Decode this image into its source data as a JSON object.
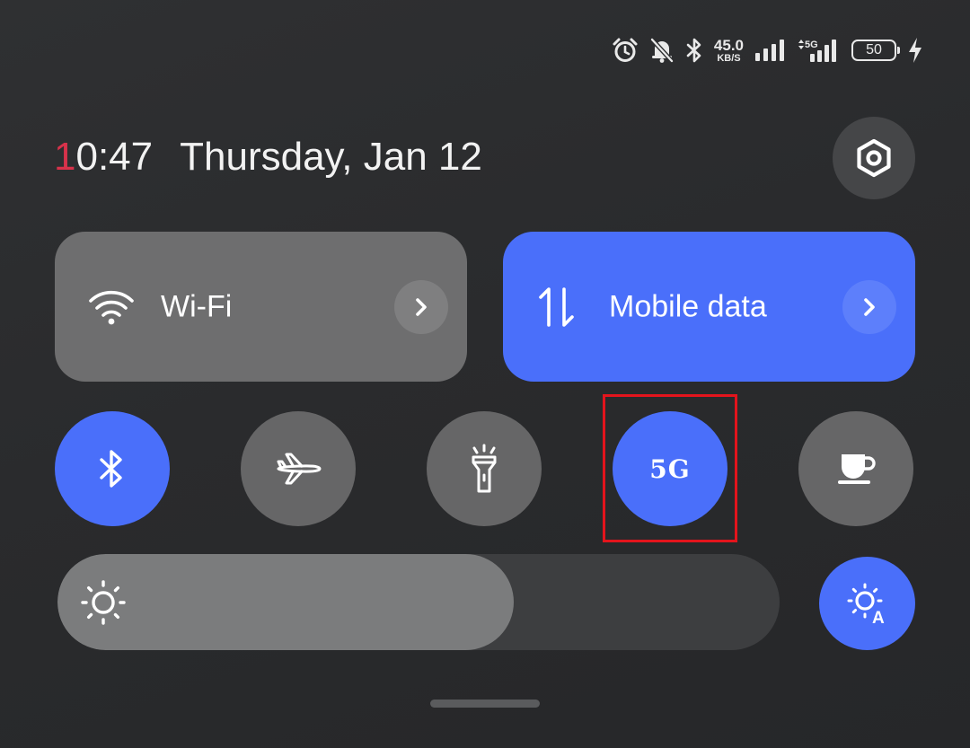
{
  "status_bar": {
    "icons": [
      "alarm-icon",
      "bell-off-icon",
      "bluetooth-icon",
      "signal-icon",
      "5g-signal-icon",
      "charging-icon"
    ],
    "speed_value": "45.0",
    "speed_unit": "KB/S",
    "network_label": "5G",
    "battery_level": "50"
  },
  "header": {
    "time_first_digit": "1",
    "time_rest": "0:47",
    "date": "Thursday, Jan 12",
    "settings_icon": "settings-hexagon-icon"
  },
  "tiles": {
    "wifi": {
      "label": "Wi-Fi",
      "icon": "wifi-icon",
      "active": false
    },
    "mobile_data": {
      "label": "Mobile data",
      "icon": "data-arrows-icon",
      "active": true
    }
  },
  "toggles": [
    {
      "name": "bluetooth",
      "icon": "bluetooth-icon",
      "active": true
    },
    {
      "name": "airplane-mode",
      "icon": "airplane-icon",
      "active": false
    },
    {
      "name": "flashlight",
      "icon": "flashlight-icon",
      "active": false
    },
    {
      "name": "5g",
      "label": "5G",
      "active": true,
      "highlighted": true
    },
    {
      "name": "reading-mode",
      "icon": "cup-icon",
      "active": false
    }
  ],
  "brightness": {
    "level": 0.632,
    "icon": "sun-icon",
    "auto_icon": "auto-brightness-icon"
  },
  "colors": {
    "accent": "#4a6ffa",
    "tile_off": "#6e6e6f",
    "toggle_off": "#666667",
    "highlight": "#e3141c",
    "clock_accent": "#d8324b",
    "background": "#2c2d2f"
  }
}
